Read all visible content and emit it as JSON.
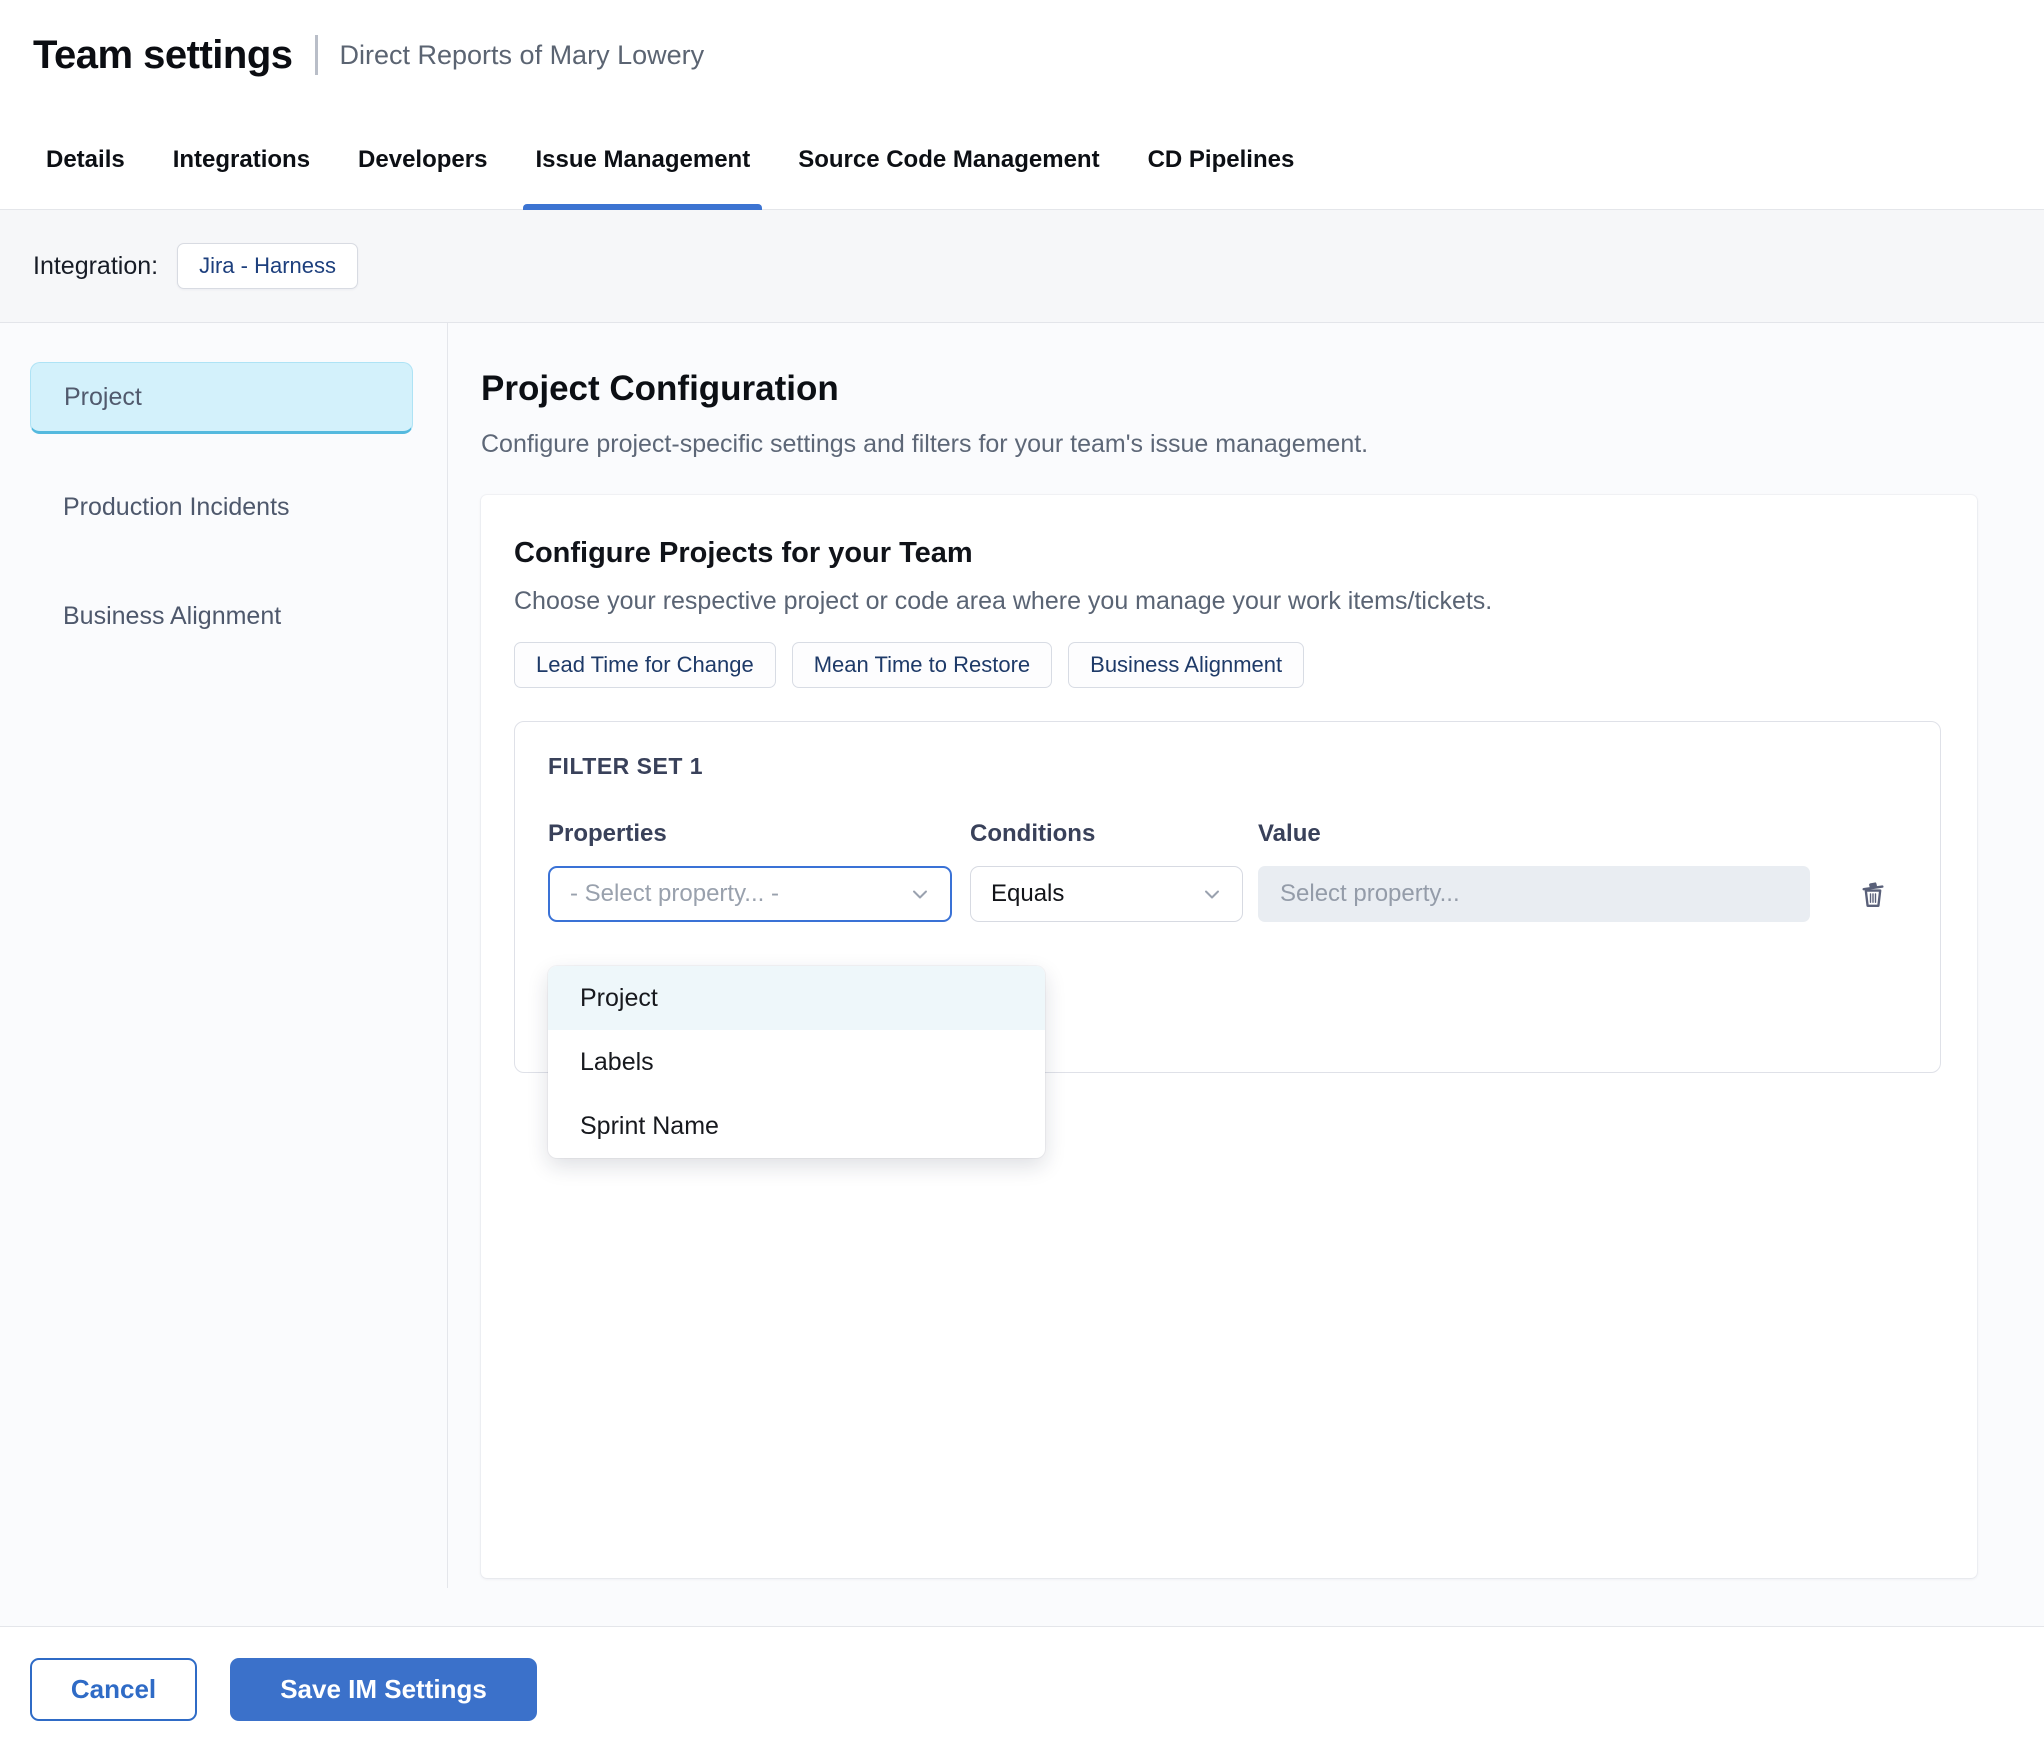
{
  "header": {
    "title": "Team settings",
    "subtitle": "Direct Reports of Mary Lowery"
  },
  "tabs": [
    {
      "label": "Details",
      "active": false
    },
    {
      "label": "Integrations",
      "active": false
    },
    {
      "label": "Developers",
      "active": false
    },
    {
      "label": "Issue Management",
      "active": true
    },
    {
      "label": "Source Code Management",
      "active": false
    },
    {
      "label": "CD Pipelines",
      "active": false
    }
  ],
  "integration": {
    "label": "Integration:",
    "value": "Jira - Harness"
  },
  "sidebar": {
    "items": [
      {
        "label": "Project",
        "active": true
      },
      {
        "label": "Production Incidents",
        "active": false
      },
      {
        "label": "Business Alignment",
        "active": false
      }
    ]
  },
  "main": {
    "title": "Project Configuration",
    "description": "Configure project-specific settings and filters for your team's issue management.",
    "card": {
      "title": "Configure Projects for your Team",
      "subtitle": "Choose your respective project or code area where you manage your work items/tickets.",
      "chips": [
        {
          "label": "Lead Time for Change"
        },
        {
          "label": "Mean Time to Restore"
        },
        {
          "label": "Business Alignment"
        }
      ],
      "filter_set": {
        "title": "FILTER SET 1",
        "columns": {
          "properties": "Properties",
          "conditions": "Conditions",
          "value": "Value"
        },
        "property_placeholder": "- Select property... -",
        "condition_value": "Equals",
        "value_placeholder": "Select property...",
        "dropdown_options": [
          {
            "label": "Project",
            "highlighted": true
          },
          {
            "label": "Labels",
            "highlighted": false
          },
          {
            "label": "Sprint Name",
            "highlighted": false
          }
        ]
      }
    }
  },
  "footer": {
    "cancel_label": "Cancel",
    "save_label": "Save IM Settings"
  },
  "colors": {
    "accent_blue": "#3b71ca",
    "tab_underline": "#3c74d2",
    "focused_select_border": "#3a72d6",
    "selected_sidebar_bg": "#d3f1fb",
    "selected_sidebar_border": "#54b9de",
    "dropdown_highlight": "#eef7fa",
    "chip_text": "#1e3a68",
    "value_input_bg": "#e9edf2"
  },
  "icons": {
    "chevron_down": "chevron-down-icon",
    "trash": "trash-icon"
  }
}
